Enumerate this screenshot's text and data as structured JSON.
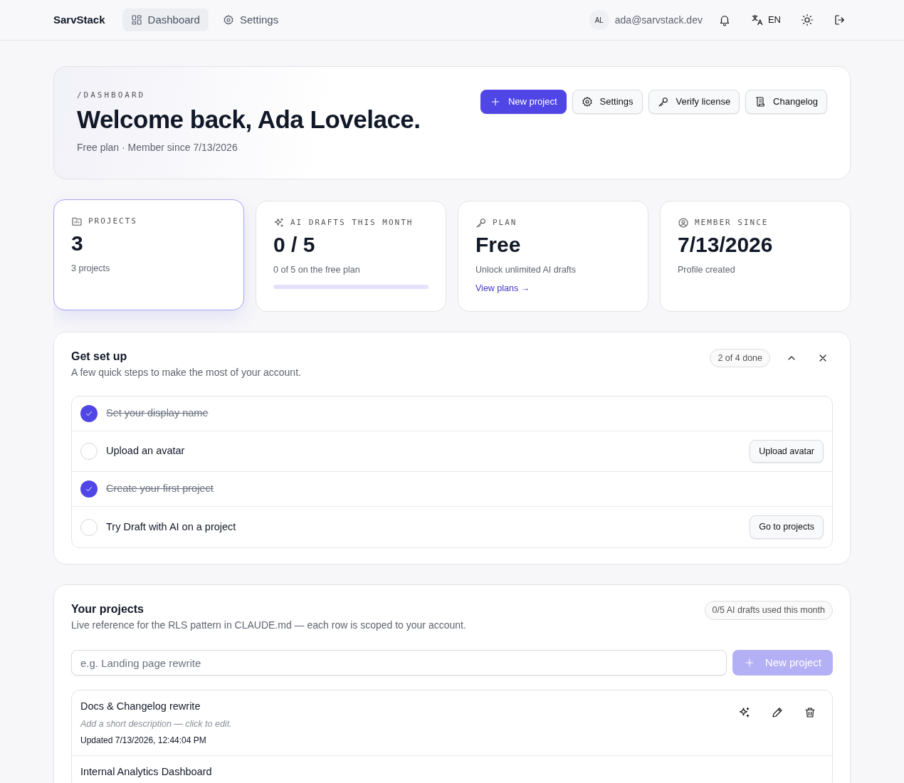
{
  "navbar": {
    "brand": "SarvStack",
    "nav_items": [
      {
        "label": "Dashboard",
        "selected": true
      },
      {
        "label": "Settings",
        "selected": false
      }
    ],
    "avatar_initials": "AL",
    "email": "ada@sarvstack.dev",
    "language": "EN"
  },
  "hero": {
    "breadcrumb": "/DASHBOARD",
    "title": "Welcome back, Ada Lovelace.",
    "subtitle": "Free plan · Member since 7/13/2026",
    "buttons": [
      {
        "label": "New project",
        "primary": true
      },
      {
        "label": "Settings",
        "primary": false
      },
      {
        "label": "Verify license",
        "primary": false
      },
      {
        "label": "Changelog",
        "primary": false
      }
    ]
  },
  "stats": [
    {
      "label": "PROJECTS",
      "value": "3",
      "caption": "3 projects",
      "highlighted": true
    },
    {
      "label": "AI DRAFTS THIS MONTH",
      "value": "0 / 5",
      "caption": "0 of 5 on the free plan",
      "highlighted": false,
      "level": 0
    },
    {
      "label": "PLAN",
      "value": "Free",
      "caption": "Unlock unlimited AI drafts",
      "highlighted": false,
      "link": "View plans →"
    },
    {
      "label": "MEMBER SINCE",
      "value": "7/13/2026",
      "caption": "Profile created",
      "highlighted": false
    }
  ],
  "setup": {
    "title": "Get set up",
    "subtitle": "A few quick steps to make the most of your account.",
    "progress_badge": "2 of 4 done",
    "expanded": true,
    "steps": [
      {
        "label": "Set your display name",
        "checked": true
      },
      {
        "label": "Upload an avatar",
        "checked": false,
        "action": "Upload avatar"
      },
      {
        "label": "Create your first project",
        "checked": true
      },
      {
        "label": "Try Draft with AI on a project",
        "checked": false,
        "action": "Go to projects"
      }
    ]
  },
  "projects": {
    "title": "Your projects",
    "subtitle": "Live reference for the RLS pattern in CLAUDE.md — each row is scoped to your account.",
    "usage_badge": "0/5 AI drafts used this month",
    "input": {
      "placeholder": "e.g. Landing page rewrite"
    },
    "new_button": {
      "label": "New project",
      "disabled": true
    },
    "rows": [
      {
        "name": "Docs & Changelog rewrite",
        "description": "Add a short description — click to edit.",
        "updated": "Updated 7/13/2026, 12:44:04 PM"
      },
      {
        "name": "Internal Analytics Dashboard"
      }
    ]
  }
}
